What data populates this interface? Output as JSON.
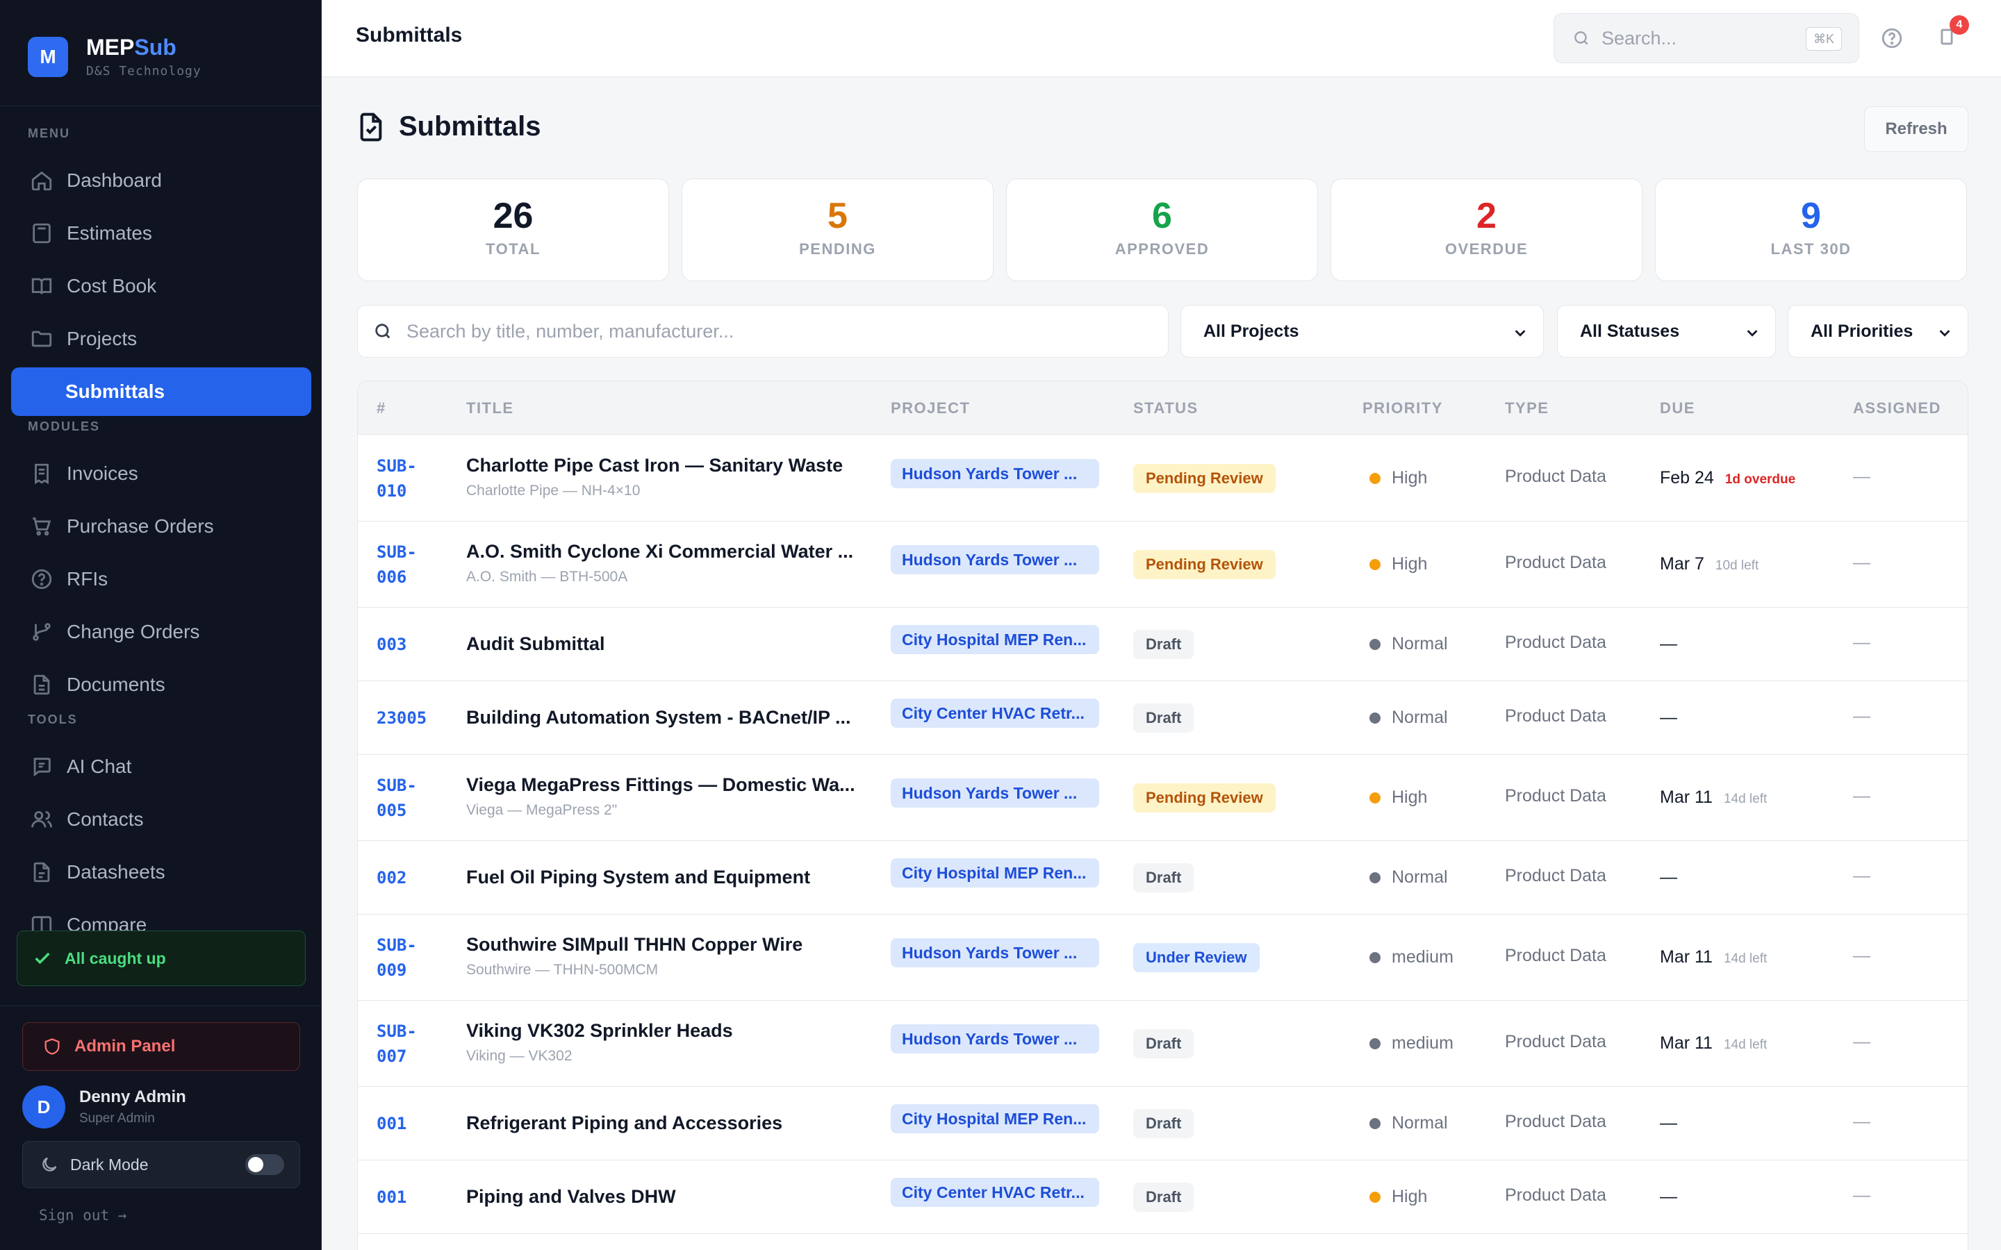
{
  "brand": {
    "name_a": "MEP",
    "name_b": "Sub",
    "logo_letter": "M",
    "company": "D&S Technology",
    "accent_color": "#2563eb"
  },
  "sidebar": {
    "menu_label": "MENU",
    "modules_label": "MODULES",
    "tools_label": "TOOLS",
    "menu": [
      {
        "label": "Dashboard",
        "icon": "home-icon"
      },
      {
        "label": "Estimates",
        "icon": "calculator-icon"
      },
      {
        "label": "Cost Book",
        "icon": "book-icon"
      },
      {
        "label": "Projects",
        "icon": "folder-icon"
      },
      {
        "label": "Submittals",
        "icon": "submittal-icon",
        "active": true
      }
    ],
    "modules": [
      {
        "label": "Invoices",
        "icon": "invoice-icon"
      },
      {
        "label": "Purchase Orders",
        "icon": "cart-icon"
      },
      {
        "label": "RFIs",
        "icon": "question-icon"
      },
      {
        "label": "Change Orders",
        "icon": "branch-icon"
      },
      {
        "label": "Documents",
        "icon": "document-icon"
      }
    ],
    "tools": [
      {
        "label": "AI Chat",
        "icon": "chat-icon"
      },
      {
        "label": "Contacts",
        "icon": "users-icon"
      },
      {
        "label": "Datasheets",
        "icon": "file-icon"
      },
      {
        "label": "Compare",
        "icon": "compare-icon"
      }
    ],
    "caught_up": "All caught up",
    "admin_panel": "Admin Panel",
    "user": {
      "initial": "D",
      "name": "Denny Admin",
      "role": "Super Admin"
    },
    "dark_mode": "Dark Mode",
    "sign_out": "Sign out →"
  },
  "topbar": {
    "title": "Submittals",
    "search_placeholder": "Search...",
    "shortcut": "⌘K",
    "notification_count": "4"
  },
  "page": {
    "title": "Submittals",
    "refresh": "Refresh"
  },
  "stats": [
    {
      "value": "26",
      "label": "TOTAL",
      "color": "#111827"
    },
    {
      "value": "5",
      "label": "PENDING",
      "color": "#d97706"
    },
    {
      "value": "6",
      "label": "APPROVED",
      "color": "#16a34a"
    },
    {
      "value": "2",
      "label": "OVERDUE",
      "color": "#dc2626"
    },
    {
      "value": "9",
      "label": "LAST 30D",
      "color": "#2563eb"
    }
  ],
  "filters": {
    "search_placeholder": "Search by title, number, manufacturer...",
    "project": "All Projects",
    "status": "All Statuses",
    "priority": "All Priorities"
  },
  "table": {
    "headers": [
      "#",
      "TITLE",
      "PROJECT",
      "STATUS",
      "PRIORITY",
      "TYPE",
      "DUE",
      "ASSIGNED"
    ],
    "rows": [
      {
        "num1": "SUB-",
        "num2": "010",
        "title": "Charlotte Pipe Cast Iron — Sanitary Waste",
        "sub": "Charlotte Pipe — NH-4×10",
        "project": "Hudson Yards Tower ...",
        "status": "Pending Review",
        "status_kind": "pending",
        "priority": "High",
        "priority_color": "#f59e0b",
        "type": "Product Data",
        "due": "Feb 24",
        "due_extra": "1d overdue",
        "due_kind": "over",
        "assigned": "—"
      },
      {
        "num1": "SUB-",
        "num2": "006",
        "title": "A.O. Smith Cyclone Xi Commercial Water ...",
        "sub": "A.O. Smith — BTH-500A",
        "project": "Hudson Yards Tower ...",
        "status": "Pending Review",
        "status_kind": "pending",
        "priority": "High",
        "priority_color": "#f59e0b",
        "type": "Product Data",
        "due": "Mar 7",
        "due_extra": "10d left",
        "due_kind": "left",
        "assigned": "—"
      },
      {
        "num1": "003",
        "num2": "",
        "title": "Audit Submittal",
        "sub": "",
        "project": "City Hospital MEP Ren...",
        "status": "Draft",
        "status_kind": "draft",
        "priority": "Normal",
        "priority_color": "#6b7280",
        "type": "Product Data",
        "due": "—",
        "due_extra": "",
        "due_kind": "",
        "assigned": "—"
      },
      {
        "num1": "23005",
        "num2": "",
        "title": "Building Automation System - BACnet/IP ...",
        "sub": "",
        "project": "City Center HVAC Retr...",
        "status": "Draft",
        "status_kind": "draft",
        "priority": "Normal",
        "priority_color": "#6b7280",
        "type": "Product Data",
        "due": "—",
        "due_extra": "",
        "due_kind": "",
        "assigned": "—"
      },
      {
        "num1": "SUB-",
        "num2": "005",
        "title": "Viega MegaPress Fittings — Domestic Wa...",
        "sub": "Viega — MegaPress 2\"",
        "project": "Hudson Yards Tower ...",
        "status": "Pending Review",
        "status_kind": "pending",
        "priority": "High",
        "priority_color": "#f59e0b",
        "type": "Product Data",
        "due": "Mar 11",
        "due_extra": "14d left",
        "due_kind": "left",
        "assigned": "—"
      },
      {
        "num1": "002",
        "num2": "",
        "title": "Fuel Oil Piping System and Equipment",
        "sub": "",
        "project": "City Hospital MEP Ren...",
        "status": "Draft",
        "status_kind": "draft",
        "priority": "Normal",
        "priority_color": "#6b7280",
        "type": "Product Data",
        "due": "—",
        "due_extra": "",
        "due_kind": "",
        "assigned": "—"
      },
      {
        "num1": "SUB-",
        "num2": "009",
        "title": "Southwire SIMpull THHN Copper Wire",
        "sub": "Southwire — THHN-500MCM",
        "project": "Hudson Yards Tower ...",
        "status": "Under Review",
        "status_kind": "under",
        "priority": "medium",
        "priority_color": "#6b7280",
        "type": "Product Data",
        "due": "Mar 11",
        "due_extra": "14d left",
        "due_kind": "left",
        "assigned": "—"
      },
      {
        "num1": "SUB-",
        "num2": "007",
        "title": "Viking VK302 Sprinkler Heads",
        "sub": "Viking — VK302",
        "project": "Hudson Yards Tower ...",
        "status": "Draft",
        "status_kind": "draft",
        "priority": "medium",
        "priority_color": "#6b7280",
        "type": "Product Data",
        "due": "Mar 11",
        "due_extra": "14d left",
        "due_kind": "left",
        "assigned": "—"
      },
      {
        "num1": "001",
        "num2": "",
        "title": "Refrigerant Piping and Accessories",
        "sub": "",
        "project": "City Hospital MEP Ren...",
        "status": "Draft",
        "status_kind": "draft",
        "priority": "Normal",
        "priority_color": "#6b7280",
        "type": "Product Data",
        "due": "—",
        "due_extra": "",
        "due_kind": "",
        "assigned": "—"
      },
      {
        "num1": "001",
        "num2": "",
        "title": "Piping and Valves DHW",
        "sub": "",
        "project": "City Center HVAC Retr...",
        "status": "Draft",
        "status_kind": "draft",
        "priority": "High",
        "priority_color": "#f59e0b",
        "type": "Product Data",
        "due": "—",
        "due_extra": "",
        "due_kind": "",
        "assigned": "—"
      }
    ]
  }
}
